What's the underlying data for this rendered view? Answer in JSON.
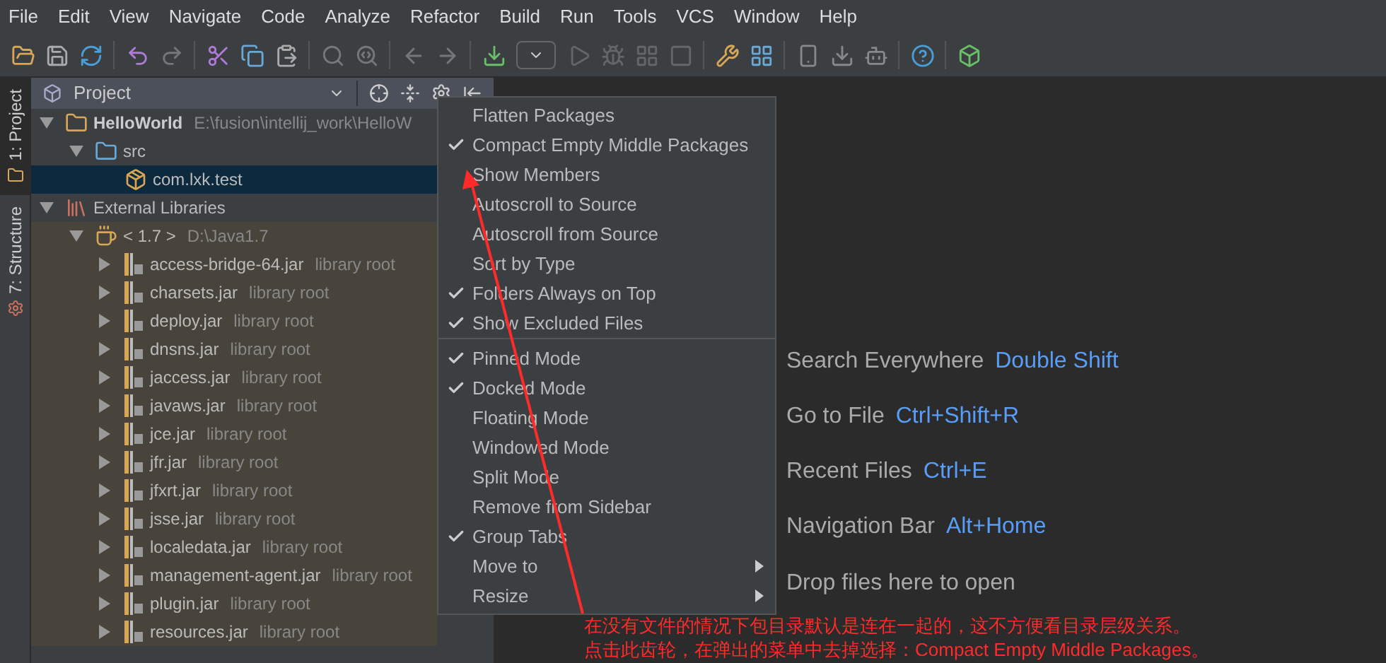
{
  "menu_bar": [
    "File",
    "Edit",
    "View",
    "Navigate",
    "Code",
    "Analyze",
    "Refactor",
    "Build",
    "Run",
    "Tools",
    "VCS",
    "Window",
    "Help"
  ],
  "side_tabs": [
    {
      "label": "1: Project",
      "selected": true
    },
    {
      "label": "7: Structure",
      "selected": false
    }
  ],
  "project_panel": {
    "title": "Project",
    "tree": [
      {
        "kind": "module",
        "name": "HelloWorld",
        "hint": "E:\\fusion\\intellij_work\\HelloW",
        "expanded": true,
        "selected": false,
        "children": [
          {
            "kind": "folder",
            "name": "src",
            "expanded": true,
            "selected": false,
            "children": [
              {
                "kind": "package",
                "name": "com.lxk.test",
                "selected": true
              }
            ]
          }
        ]
      },
      {
        "kind": "libraries",
        "name": "External Libraries",
        "expanded": true,
        "selected": false,
        "children": [
          {
            "kind": "jdk",
            "name": "< 1.7 >",
            "hint": "D:\\Java1.7",
            "expanded": true,
            "selected": false,
            "children": [
              {
                "kind": "jar",
                "name": "access-bridge-64.jar",
                "hint": "library root",
                "expanded": false,
                "selected": false
              },
              {
                "kind": "jar",
                "name": "charsets.jar",
                "hint": "library root",
                "expanded": false,
                "selected": false
              },
              {
                "kind": "jar",
                "name": "deploy.jar",
                "hint": "library root",
                "expanded": false,
                "selected": false
              },
              {
                "kind": "jar",
                "name": "dnsns.jar",
                "hint": "library root",
                "expanded": false,
                "selected": false
              },
              {
                "kind": "jar",
                "name": "jaccess.jar",
                "hint": "library root",
                "expanded": false,
                "selected": false
              },
              {
                "kind": "jar",
                "name": "javaws.jar",
                "hint": "library root",
                "expanded": false,
                "selected": false
              },
              {
                "kind": "jar",
                "name": "jce.jar",
                "hint": "library root",
                "expanded": false,
                "selected": false
              },
              {
                "kind": "jar",
                "name": "jfr.jar",
                "hint": "library root",
                "expanded": false,
                "selected": false
              },
              {
                "kind": "jar",
                "name": "jfxrt.jar",
                "hint": "library root",
                "expanded": false,
                "selected": false
              },
              {
                "kind": "jar",
                "name": "jsse.jar",
                "hint": "library root",
                "expanded": false,
                "selected": false
              },
              {
                "kind": "jar",
                "name": "localedata.jar",
                "hint": "library root",
                "expanded": false,
                "selected": false
              },
              {
                "kind": "jar",
                "name": "management-agent.jar",
                "hint": "library root",
                "expanded": false,
                "selected": false
              },
              {
                "kind": "jar",
                "name": "plugin.jar",
                "hint": "library root",
                "expanded": false,
                "selected": false
              },
              {
                "kind": "jar",
                "name": "resources.jar",
                "hint": "library root",
                "expanded": false,
                "selected": false
              }
            ]
          }
        ]
      }
    ]
  },
  "popup_menu": {
    "groups": [
      [
        {
          "label": "Flatten Packages",
          "checked": false,
          "submenu": false
        },
        {
          "label": "Compact Empty Middle Packages",
          "checked": true,
          "submenu": false
        },
        {
          "label": "Show Members",
          "checked": false,
          "submenu": false
        },
        {
          "label": "Autoscroll to Source",
          "checked": false,
          "submenu": false
        },
        {
          "label": "Autoscroll from Source",
          "checked": false,
          "submenu": false
        },
        {
          "label": "Sort by Type",
          "checked": false,
          "submenu": false
        },
        {
          "label": "Folders Always on Top",
          "checked": true,
          "submenu": false
        },
        {
          "label": "Show Excluded Files",
          "checked": true,
          "submenu": false
        }
      ],
      [
        {
          "label": "Pinned Mode",
          "checked": true,
          "submenu": false
        },
        {
          "label": "Docked Mode",
          "checked": true,
          "submenu": false
        },
        {
          "label": "Floating Mode",
          "checked": false,
          "submenu": false
        },
        {
          "label": "Windowed Mode",
          "checked": false,
          "submenu": false
        },
        {
          "label": "Split Mode",
          "checked": false,
          "submenu": false
        },
        {
          "label": "Remove from Sidebar",
          "checked": false,
          "submenu": false
        },
        {
          "label": "Group Tabs",
          "checked": true,
          "submenu": false
        },
        {
          "label": "Move to",
          "checked": false,
          "submenu": true
        },
        {
          "label": "Resize",
          "checked": false,
          "submenu": true
        }
      ]
    ]
  },
  "editor_hints": [
    {
      "label": "Search Everywhere",
      "shortcut": "Double Shift"
    },
    {
      "label": "Go to File",
      "shortcut": "Ctrl+Shift+R"
    },
    {
      "label": "Recent Files",
      "shortcut": "Ctrl+E"
    },
    {
      "label": "Navigation Bar",
      "shortcut": "Alt+Home"
    }
  ],
  "drop_hint": "Drop files here to open",
  "annotation": [
    "在没有文件的情况下包目录默认是连在一起的，这不方便看目录层级关系。",
    "点击此齿轮，在弹出的菜单中去掉选择：Compact Empty Middle Packages。"
  ]
}
